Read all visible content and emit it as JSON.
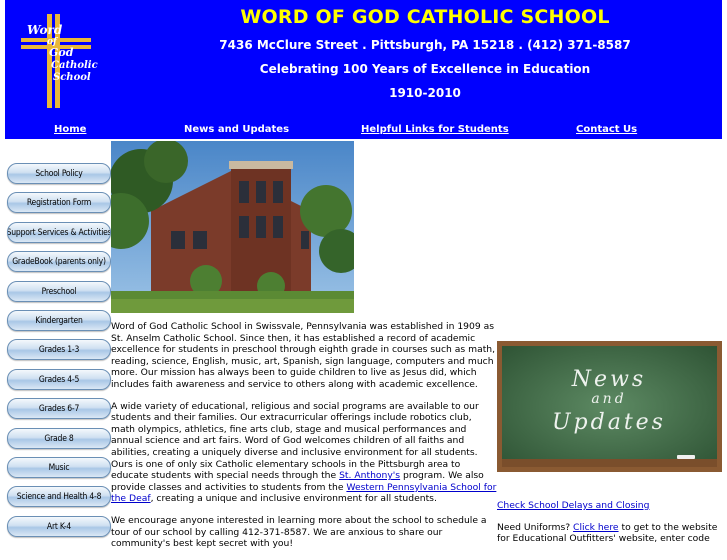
{
  "header": {
    "title": "WORD OF GOD CATHOLIC SCHOOL",
    "address": "7436 McClure Street . Pittsburgh, PA 15218 . (412) 371-8587",
    "tagline": "Celebrating 100 Years of Excellence in Education",
    "years": "1910-2010",
    "logo_text": [
      "Word",
      "of",
      "God",
      "Catholic",
      "School"
    ]
  },
  "topnav": [
    {
      "label": "Home"
    },
    {
      "label": "News and Updates"
    },
    {
      "label": "Helpful Links for Students"
    },
    {
      "label": "Contact Us"
    }
  ],
  "sidebar": {
    "items": [
      {
        "label": "School Policy"
      },
      {
        "label": "Registration Form"
      },
      {
        "label": "Support Services & Activities"
      },
      {
        "label": "GradeBook (parents only)"
      },
      {
        "label": "Preschool"
      },
      {
        "label": "Kindergarten"
      },
      {
        "label": "Grades 1-3"
      },
      {
        "label": "Grades 4-5"
      },
      {
        "label": "Grades 6-7"
      },
      {
        "label": "Grade 8"
      },
      {
        "label": "Music"
      },
      {
        "label": "Science and Health 4-8"
      },
      {
        "label": "Art K-4"
      }
    ]
  },
  "main": {
    "p1": "Word of God Catholic School in Swissvale, Pennsylvania was established in 1909 as St. Anselm Catholic School.  Since then, it has established a record of academic excellence for students in preschool through eighth grade in courses such as math, reading, science, English, music, art, Spanish, sign language, computers and much more.  Our mission has always been to guide children to live as Jesus did,  which includes faith awareness and service to others along with academic excellence.",
    "p2_a": "A wide variety of educational, religious and social programs are available to our students and their families.  Our extracurricular offerings include robotics club, math olympics, athletics, fine arts club, stage and musical performances and annual science and art fairs.  Word of God welcomes children of all faiths and abilities, creating a uniquely diverse and inclusive environment for all students. Ours is one of only six Catholic elementary schools in the Pittsburgh area to educate students with special needs through the ",
    "p2_link1": "St. Anthony's",
    "p2_b": " program.  We also provide classes and activities to students from the ",
    "p2_link2": "Western Pennsylvania School for the Deaf",
    "p2_c": ", creating a unique and inclusive environment for all students.",
    "p3": "We encourage anyone interested in learning more about the school to schedule a tour of our school by calling 412-371-8587.  We are anxious to share our community's best kept secret with you!"
  },
  "news_board": {
    "line1": "News",
    "line2": "and",
    "line3": "Updates"
  },
  "right": {
    "delays_link": "Check School Delays and Closing",
    "uniform_prefix": "Need Uniforms?  ",
    "uniform_link": "Click here",
    "uniform_suffix": " to get to the website for Educational Outfitters' website, enter code"
  },
  "colors": {
    "header_bg": "#0000ff",
    "title": "#ffff00",
    "link": "#0000cc",
    "board": "#3f6b44"
  }
}
